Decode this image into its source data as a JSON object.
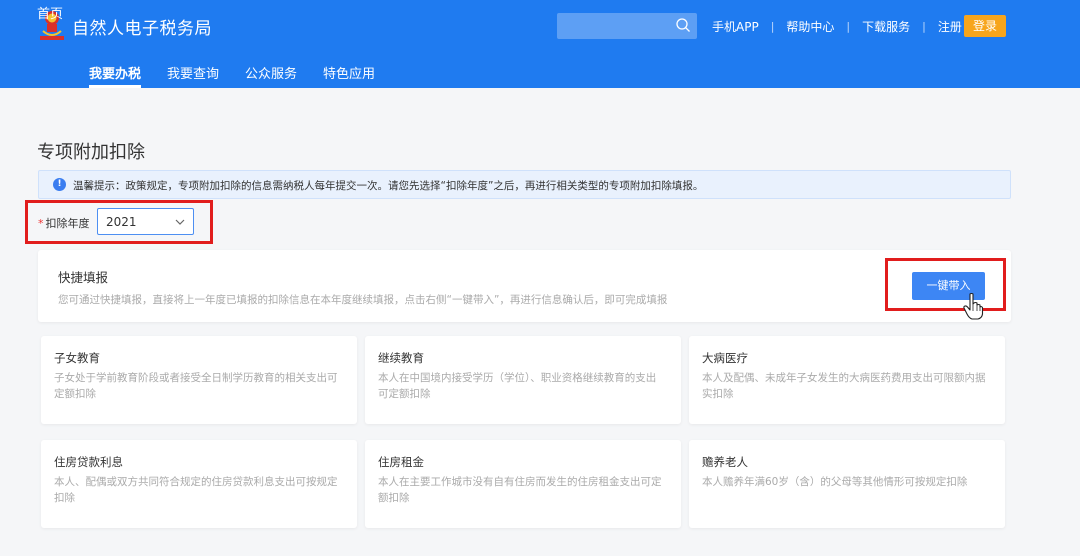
{
  "header": {
    "title": "自然人电子税务局",
    "search_placeholder": "",
    "links": [
      "手机APP",
      "帮助中心",
      "下载服务",
      "注册"
    ],
    "login_label": "登录",
    "colors": {
      "brand": "#1f7bf0",
      "login": "#f7a51c"
    }
  },
  "nav": {
    "items": [
      "首页",
      "我要办税",
      "我要查询",
      "公众服务",
      "特色应用"
    ],
    "active": "我要办税"
  },
  "main": {
    "title": "专项附加扣除",
    "notice": "温馨提示：政策规定，专项附加扣除的信息需纳税人每年提交一次。请您先选择“扣除年度”之后，再进行相关类型的专项附加扣除填报。",
    "year_label": "扣除年度",
    "year_required_mark": "*",
    "year_value": "2021",
    "quick": {
      "title": "快捷填报",
      "description": "您可通过快捷填报，直接将上一年度已填报的扣除信息在本年度继续填报，点击右侧“一键带入”，再进行信息确认后，即可完成填报",
      "button": "一键带入"
    },
    "cards": [
      {
        "title": "子女教育",
        "desc": "子女处于学前教育阶段或者接受全日制学历教育的相关支出可定额扣除"
      },
      {
        "title": "继续教育",
        "desc": "本人在中国境内接受学历（学位）、职业资格继续教育的支出可定额扣除"
      },
      {
        "title": "大病医疗",
        "desc": "本人及配偶、未成年子女发生的大病医药费用支出可限额内据实扣除"
      },
      {
        "title": "住房贷款利息",
        "desc": "本人、配偶或双方共同符合规定的住房贷款利息支出可按规定扣除"
      },
      {
        "title": "住房租金",
        "desc": "本人在主要工作城市没有自有住房而发生的住房租金支出可定额扣除"
      },
      {
        "title": "赡养老人",
        "desc": "本人赡养年满60岁（含）的父母等其他情形可按规定扣除"
      }
    ]
  },
  "highlight_color": "#e11d1d"
}
